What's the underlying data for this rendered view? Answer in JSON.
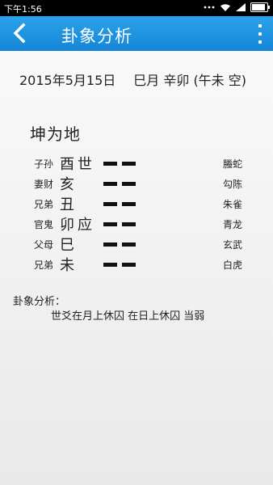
{
  "status_bar": {
    "time": "下午1:56"
  },
  "toolbar": {
    "title": "卦象分析"
  },
  "date_line": {
    "date": "2015年5月15日",
    "lunar": "巳月  辛卯 (午未 空)"
  },
  "gua": {
    "name": "坤为地"
  },
  "lines": [
    {
      "relation": "子孙",
      "branch": "酉",
      "shiying": "世",
      "god": "螣蛇"
    },
    {
      "relation": "妻财",
      "branch": "亥",
      "shiying": "",
      "god": "勾陈"
    },
    {
      "relation": "兄弟",
      "branch": "丑",
      "shiying": "",
      "god": "朱雀"
    },
    {
      "relation": "官鬼",
      "branch": "卯",
      "shiying": "应",
      "god": "青龙"
    },
    {
      "relation": "父母",
      "branch": "巳",
      "shiying": "",
      "god": "玄武"
    },
    {
      "relation": "兄弟",
      "branch": "未",
      "shiying": "",
      "god": "白虎"
    }
  ],
  "analysis": {
    "label": "卦象分析：",
    "text": "世爻在月上休囚 在日上休囚 当弱"
  },
  "colors": {
    "toolbar": "#1b93e0",
    "statusbar": "#000000"
  }
}
